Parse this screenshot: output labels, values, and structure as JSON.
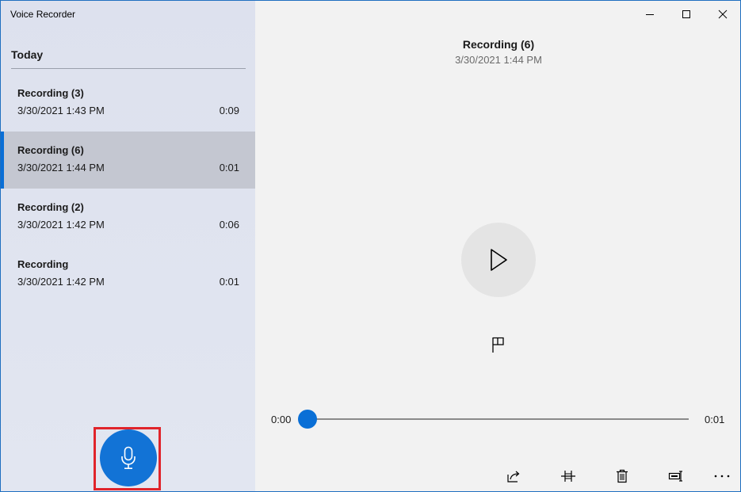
{
  "app": {
    "title": "Voice Recorder"
  },
  "window_controls": {
    "minimize_icon": "minimize-icon",
    "maximize_icon": "maximize-icon",
    "close_icon": "close-icon"
  },
  "sidebar": {
    "group_header": "Today",
    "recordings": [
      {
        "name": "Recording (3)",
        "date": "3/30/2021 1:43 PM",
        "duration": "0:09",
        "selected": false
      },
      {
        "name": "Recording (6)",
        "date": "3/30/2021 1:44 PM",
        "duration": "0:01",
        "selected": true
      },
      {
        "name": "Recording (2)",
        "date": "3/30/2021 1:42 PM",
        "duration": "0:06",
        "selected": false
      },
      {
        "name": "Recording",
        "date": "3/30/2021 1:42 PM",
        "duration": "0:01",
        "selected": false
      }
    ],
    "record_button_icon": "microphone-icon"
  },
  "player": {
    "title": "Recording (6)",
    "date": "3/30/2021 1:44 PM",
    "play_icon": "play-icon",
    "marker_icon": "flag-icon",
    "current_time": "0:00",
    "total_time": "0:01",
    "progress": 0
  },
  "toolbar": {
    "icons": [
      "share-icon",
      "trim-icon",
      "delete-icon",
      "rename-icon",
      "more-icon"
    ]
  },
  "colors": {
    "accent": "#0a6fd6",
    "record_button": "#1273d6",
    "highlight_frame": "#e0242b",
    "selected_row": "#c4c7d1"
  }
}
